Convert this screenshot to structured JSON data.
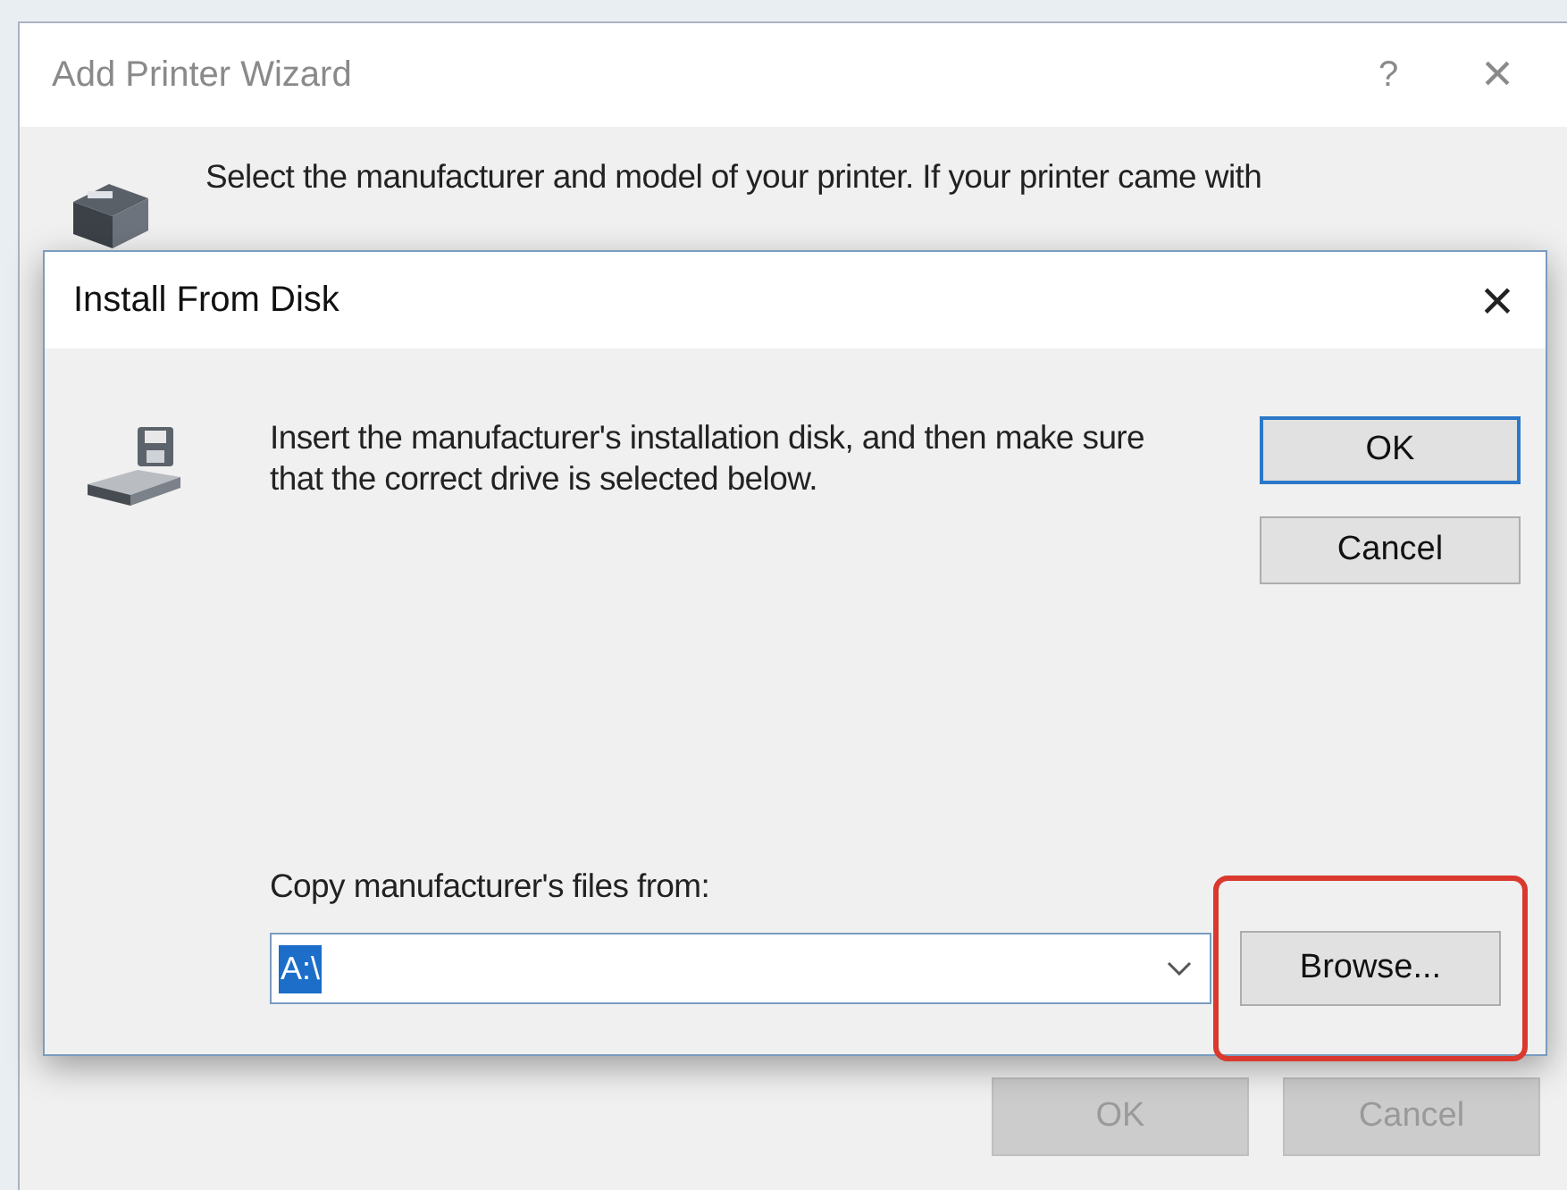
{
  "wizard": {
    "title": "Add Printer Wizard",
    "help": "?",
    "close": "×",
    "instructions": "Select the manufacturer and model of your printer. If your printer came with",
    "buttons": [
      {
        "label": "OK",
        "disabled": true
      },
      {
        "label": "Cancel",
        "disabled": true
      }
    ]
  },
  "dialog": {
    "title": "Install From Disk",
    "close": "×",
    "message": "Insert the manufacturer's installation disk, and then make sure that the correct drive is selected below.",
    "buttons": [
      {
        "label": "OK",
        "default": true
      },
      {
        "label": "Cancel",
        "default": false
      }
    ],
    "copy_label": "Copy manufacturer's files from:",
    "path": "A:\\",
    "browse": {
      "label": "Browse...",
      "highlighted": true
    }
  }
}
